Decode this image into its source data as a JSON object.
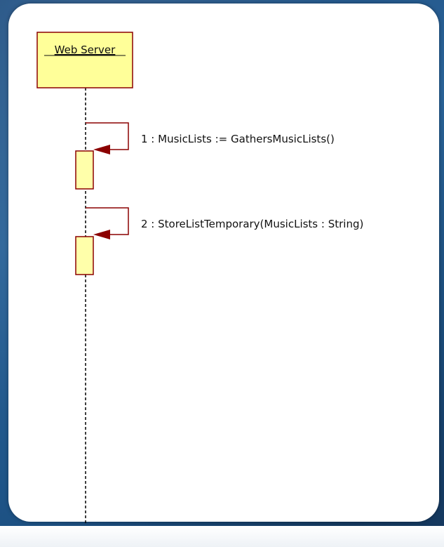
{
  "diagram": {
    "lifeline": {
      "name": "Web Server"
    },
    "messages": [
      {
        "label": "1 : MusicLists := GathersMusicLists()"
      },
      {
        "label": "2 : StoreListTemporary(MusicLists : String)"
      }
    ],
    "colors": {
      "box_fill": "#ffff99",
      "activation_fill": "#ffffaa",
      "stroke": "#8b0000",
      "lifeline": "#000000",
      "background": "#2a6398"
    }
  }
}
